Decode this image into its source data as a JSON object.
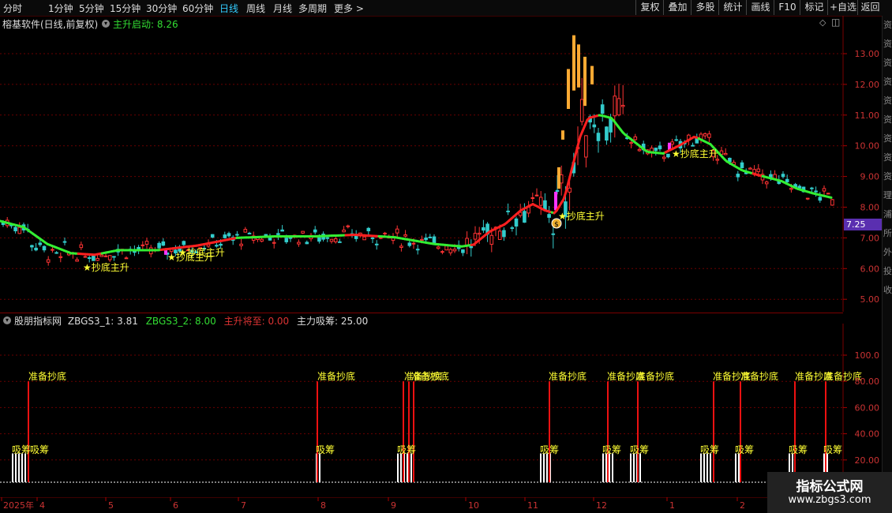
{
  "toolbar": {
    "timeframes": [
      "分时",
      "1分钟",
      "5分钟",
      "15分钟",
      "30分钟",
      "60分钟",
      "日线",
      "周线",
      "月线",
      "多周期",
      "更多 >"
    ],
    "active_index": 6,
    "right_buttons": [
      "复权",
      "叠加",
      "多股",
      "统计",
      "画线",
      "F10",
      "标记",
      "+自选",
      "返回"
    ]
  },
  "main_header": {
    "stock_title": "榕基软件(日线,前复权)",
    "indicator_label": "主升启动:",
    "indicator_value": "8.26"
  },
  "price_axis": {
    "ticks": [
      "13.00",
      "12.00",
      "11.00",
      "10.00",
      "9.00",
      "8.00",
      "7.00",
      "6.00",
      "5.00"
    ],
    "current_price": "7.25",
    "current_price_color": "#5a2fb0"
  },
  "signals_main": {
    "label": "抄底主升",
    "labels": [
      "★抄底主升",
      "★抄底主升",
      "★抄底主升",
      "★抄底主升",
      "★抄底主升"
    ]
  },
  "sub_header": {
    "title": "股朋指标网",
    "items": [
      {
        "label": "ZBGS3_1:",
        "value": "3.81",
        "color": "#dddddd"
      },
      {
        "label": "ZBGS3_2:",
        "value": "8.00",
        "color": "#33dd33"
      },
      {
        "label": "主升将至:",
        "value": "0.00",
        "color": "#dd3333"
      },
      {
        "label": "主力吸筹:",
        "value": "25.00",
        "color": "#dddddd"
      }
    ]
  },
  "sub_axis": {
    "ticks": [
      "100.0",
      "80.00",
      "60.00",
      "40.00",
      "20.00"
    ]
  },
  "sub_signals": {
    "ready_label": "准备抄底",
    "absorb_label": "吸筹",
    "ready_labels": [
      "准备抄底",
      "准备抄底",
      "准备抄底",
      "准备抄底",
      "准备抄底",
      "准备抄底",
      "准备抄底",
      "准备抄底",
      "准备抄底",
      "准备抄底",
      "准备抄底"
    ],
    "absorb_labels": [
      "吸筹",
      "吸筹",
      "吸筹",
      "吸筹",
      "吸筹",
      "吸筹",
      "吸筹",
      "吸筹",
      "吸筹",
      "吸筹",
      "吸筹"
    ]
  },
  "date_axis": {
    "labels": [
      "2025年",
      "4",
      "5",
      "6",
      "7",
      "8",
      "9",
      "10",
      "11",
      "12",
      "1",
      "2"
    ]
  },
  "watermark": {
    "line1": "指标公式网",
    "line2": "www.zbgs3.com"
  },
  "sidebar": {
    "chars": [
      "资",
      "资",
      "资",
      "资",
      "资",
      "资",
      "资",
      "资",
      "资",
      "理",
      "浦",
      "所",
      "外",
      "投",
      "收"
    ]
  },
  "colors": {
    "up": "#ff3333",
    "down": "#33cccc",
    "rise_line": "#ff2020",
    "fall_line": "#33ee33",
    "signal": "#ffff33",
    "magenta": "#ff33ff"
  }
}
